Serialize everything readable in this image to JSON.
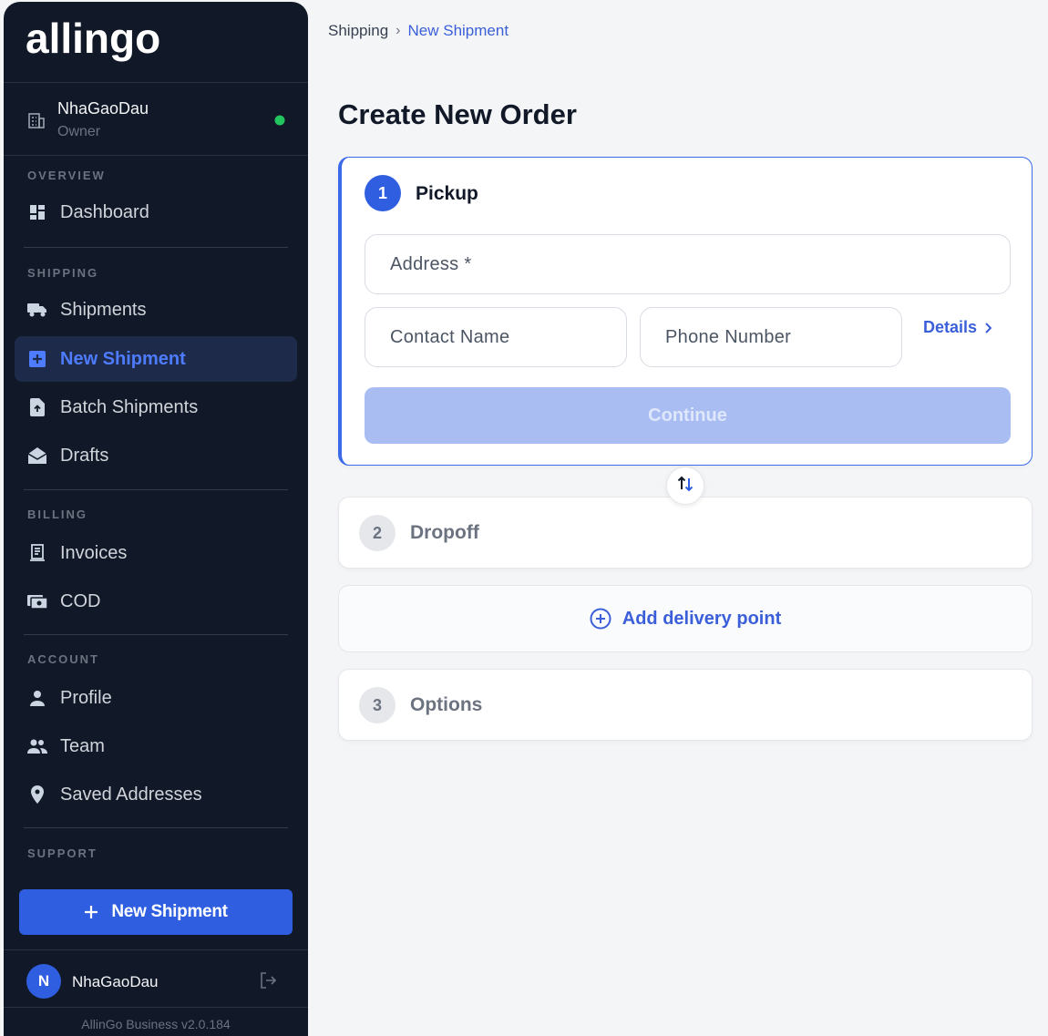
{
  "sidebar": {
    "brand": "allingo",
    "org": {
      "name": "NhaGaoDau",
      "role": "Owner",
      "status_color": "#22c55e"
    },
    "sections": {
      "overview": "OVERVIEW",
      "shipping": "SHIPPING",
      "billing": "BILLING",
      "account": "ACCOUNT",
      "support": "SUPPORT"
    },
    "items": {
      "dashboard": "Dashboard",
      "shipments": "Shipments",
      "new_shipment": "New Shipment",
      "batch_shipments": "Batch Shipments",
      "drafts": "Drafts",
      "invoices": "Invoices",
      "cod": "COD",
      "profile": "Profile",
      "team": "Team",
      "saved_addresses": "Saved Addresses"
    },
    "cta_label": "New Shipment",
    "user": {
      "initial": "N",
      "name": "NhaGaoDau"
    },
    "version": "AllinGo Business v2.0.184"
  },
  "breadcrumb": {
    "parent": "Shipping",
    "separator": "›",
    "current": "New Shipment"
  },
  "page_title": "Create New Order",
  "steps": {
    "pickup": {
      "number": "1",
      "title": "Pickup",
      "address_placeholder": "Address *",
      "contact_placeholder": "Contact Name",
      "phone_placeholder": "Phone Number",
      "details_label": "Details",
      "continue_label": "Continue"
    },
    "dropoff": {
      "number": "2",
      "title": "Dropoff"
    },
    "add_point_label": "Add delivery point",
    "options": {
      "number": "3",
      "title": "Options"
    }
  },
  "colors": {
    "primary": "#2f5fe0",
    "sidebar_bg": "#111827",
    "continue_disabled": "#a9bdf2"
  }
}
